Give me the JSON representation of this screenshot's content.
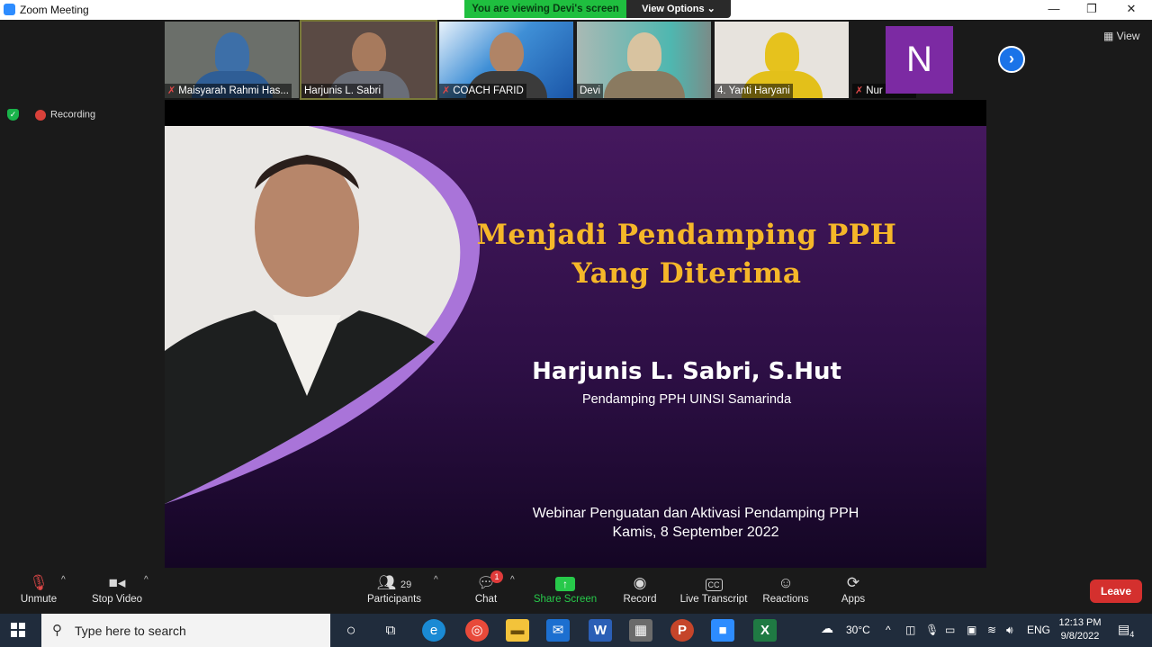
{
  "window": {
    "title": "Zoom Meeting",
    "minimize": "—",
    "restore": "❐",
    "close": "✕"
  },
  "banner": {
    "viewing": "You are viewing Devi's screen",
    "view_options": "View Options ⌄"
  },
  "participants": [
    {
      "name": "Maisyarah Rahmi Has...",
      "muted": true
    },
    {
      "name": "Harjunis L. Sabri",
      "muted": false
    },
    {
      "name": "COACH FARID",
      "muted": true
    },
    {
      "name": "Devi",
      "muted": false
    },
    {
      "name": "4. Yanti Haryani",
      "muted": false
    },
    {
      "name": "Nur Wasis",
      "muted": true,
      "initial": "N"
    }
  ],
  "view_button": "View",
  "recording": "Recording",
  "slide": {
    "title_line1": "Menjadi Pendamping PPH",
    "title_line2": "Yang Diterima",
    "presenter": "Harjunis L. Sabri, S.Hut",
    "role": "Pendamping PPH UINSI Samarinda",
    "event": "Webinar Penguatan dan Aktivasi Pendamping PPH",
    "date": "Kamis, 8 September 2022"
  },
  "toolbar": {
    "unmute": "Unmute",
    "stop_video": "Stop Video",
    "participants": "Participants",
    "participants_count": "29",
    "chat": "Chat",
    "chat_badge": "1",
    "share_screen": "Share Screen",
    "record": "Record",
    "live_transcript": "Live Transcript",
    "cc": "CC",
    "reactions": "Reactions",
    "apps": "Apps",
    "leave": "Leave"
  },
  "taskbar": {
    "search_placeholder": "Type here to search",
    "temperature": "30°C",
    "language": "ENG",
    "time": "12:13 PM",
    "date": "9/8/2022",
    "notifications": "4"
  },
  "colors": {
    "zoom_blue": "#2d8cff",
    "share_green": "#1fbf3f",
    "leave_red": "#d4302e",
    "slide_gold": "#f5b729",
    "slide_purple": "#45185e"
  }
}
